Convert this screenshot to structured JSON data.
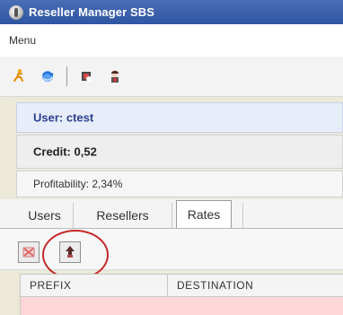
{
  "window": {
    "title": "Reseller Manager SBS"
  },
  "menu": {
    "items": [
      "Menu"
    ]
  },
  "toolbar": {
    "icons": [
      "runner-icon",
      "refresh-icon",
      "user-settings-icon",
      "user-icon"
    ]
  },
  "info_panel": {
    "user": "User: ctest",
    "credit": "Credit: 0,52",
    "profitability": "Profitability: 2,34%"
  },
  "tabs": {
    "items": [
      "Users",
      "Resellers",
      "Rates"
    ],
    "active": "Rates"
  },
  "rates_toolbar": {
    "icons": [
      "delete-icon",
      "rate-icon"
    ]
  },
  "table": {
    "columns": [
      "PREFIX",
      "DESTINATION"
    ]
  },
  "colors": {
    "titlebar": "#3f63ad",
    "highlight": "#c42828",
    "user_text": "#2b3f8f",
    "row_highlight": "#ffd7d7"
  }
}
